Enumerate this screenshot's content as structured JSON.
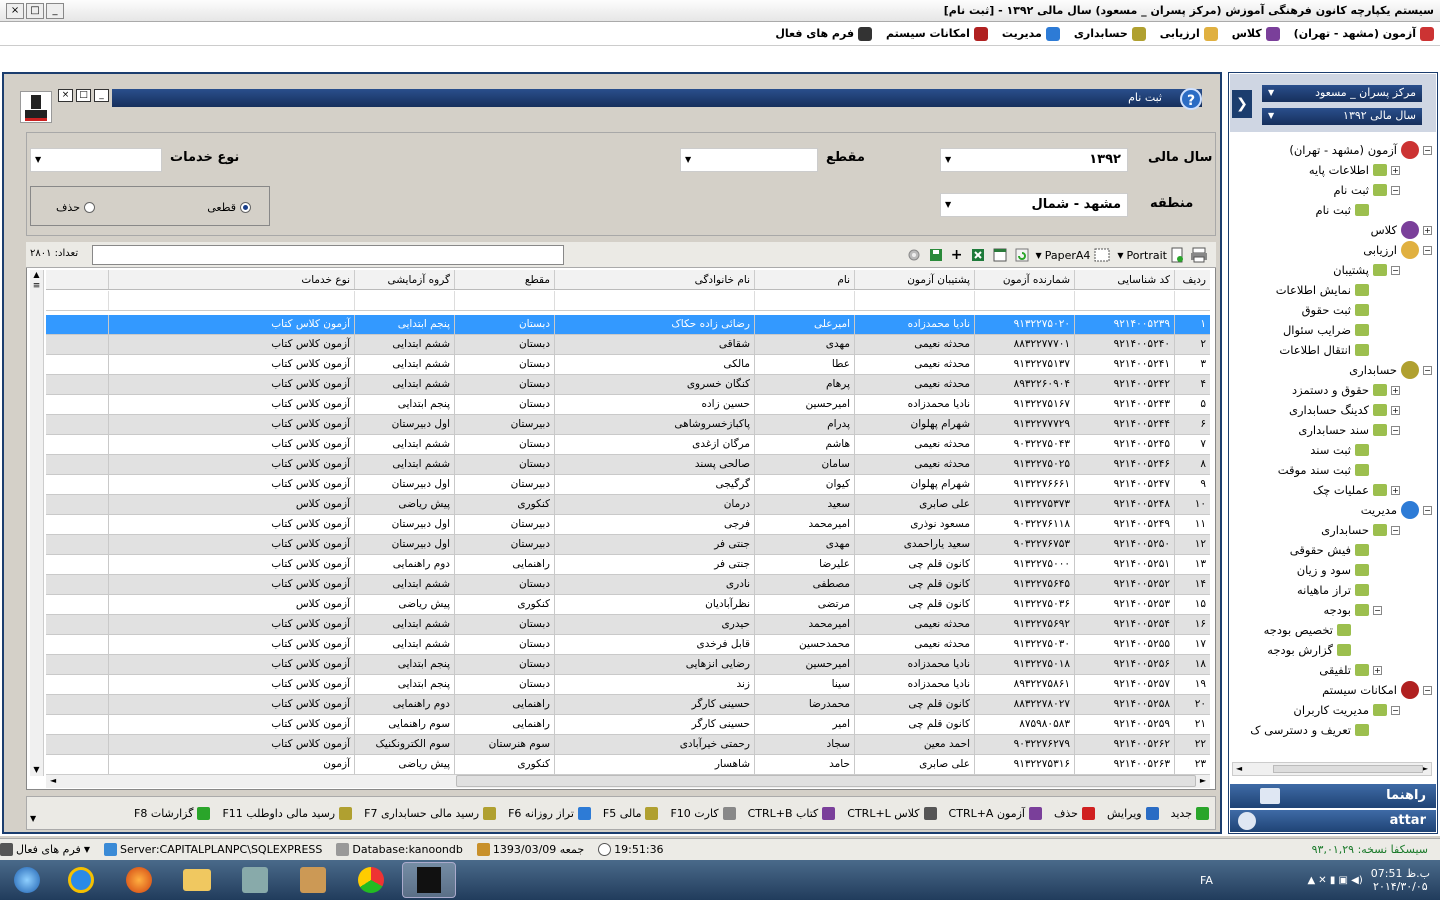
{
  "window": {
    "title": "سیستم یکپارچه کانون فرهنگی آموزش  (مرکز پسران _ مسعود) سال مالی ۱۳۹۲ - [ثبت نام]",
    "controls": [
      "_",
      "□",
      "×"
    ]
  },
  "menubar": [
    {
      "label": "آزمون (مشهد - تهران)",
      "icon": "puzzle-icon",
      "color": "#c33"
    },
    {
      "label": "کلاس",
      "icon": "chess-icon",
      "color": "#7a3f9a"
    },
    {
      "label": "ارزیابی",
      "icon": "gauge-icon",
      "color": "#e0b040"
    },
    {
      "label": "حسابداری",
      "icon": "money-bag-icon",
      "color": "#b0a030"
    },
    {
      "label": "مدیریت",
      "icon": "gear-icon",
      "color": "#2d7bd6"
    },
    {
      "label": "امکانات سیستم",
      "icon": "grid-icon",
      "color": "#b02020"
    },
    {
      "label": "فرم های فعال",
      "icon": "window-icon",
      "color": "#333"
    }
  ],
  "form": {
    "title": "ثبت نام",
    "filters": {
      "year_label": "سال مالی",
      "year_value": "۱۳۹۲",
      "grade_label": "مقطع",
      "grade_value": "",
      "service_label": "نوع خدمات",
      "service_value": "",
      "region_label": "منطقه",
      "region_value": "مشهد - شمال",
      "radio_final": "قطعی",
      "radio_delete": "حذف"
    },
    "toolbar": {
      "portrait": "Portrait",
      "paper": "PaperA4",
      "plus": "+",
      "count": "تعداد: ۲۸۰۱"
    },
    "columns": [
      "ردیف",
      "کد شناسایی",
      "شمارنده آزمون",
      "پشتیبان آزمون",
      "نام",
      "نام خانوادگی",
      "مقطع",
      "گروه آزمایشی",
      "نوع خدمات"
    ],
    "rows": [
      [
        "۱",
        "۹۲۱۴۰۰۵۲۳۹",
        "۹۱۳۲۲۷۵۰۲۰",
        "نادیا محمدزاده",
        "امیرعلی",
        "رضائی زاده حکاک",
        "دبستان",
        "پنجم ابتدایی",
        "آزمون  کلاس کتاب"
      ],
      [
        "۲",
        "۹۲۱۴۰۰۵۲۴۰",
        "۸۸۳۲۲۷۷۷۰۱",
        "محدثه نعیمی",
        "مهدی",
        "شقاقی",
        "دبستان",
        "ششم ابتدایی",
        "آزمون  کلاس کتاب"
      ],
      [
        "۳",
        "۹۲۱۴۰۰۵۲۴۱",
        "۹۱۳۲۲۷۵۱۳۷",
        "محدثه نعیمی",
        "عطا",
        "مالکی",
        "دبستان",
        "ششم ابتدایی",
        "آزمون  کلاس کتاب"
      ],
      [
        "۴",
        "۹۲۱۴۰۰۵۲۴۲",
        "۸۹۳۲۲۶۰۹۰۴",
        "محدثه نعیمی",
        "پرهام",
        "کنگان خسروی",
        "دبستان",
        "ششم ابتدایی",
        "آزمون  کلاس کتاب"
      ],
      [
        "۵",
        "۹۲۱۴۰۰۵۲۴۳",
        "۹۱۳۲۲۷۵۱۶۷",
        "نادیا محمدزاده",
        "امیرحسین",
        "حسین زاده",
        "دبستان",
        "پنجم ابتدایی",
        "آزمون  کلاس کتاب"
      ],
      [
        "۶",
        "۹۲۱۴۰۰۵۲۴۴",
        "۹۱۳۲۲۷۷۷۲۹",
        "شهرام پهلوان",
        "پدرام",
        "پاکبازخسروشاهی",
        "دبیرستان",
        "اول دبیرستان",
        "آزمون  کلاس کتاب"
      ],
      [
        "۷",
        "۹۲۱۴۰۰۵۲۴۵",
        "۹۰۳۲۲۷۵۰۴۳",
        "محدثه نعیمی",
        "هاشم",
        "مرگان ازغدی",
        "دبستان",
        "ششم ابتدایی",
        "آزمون  کلاس کتاب"
      ],
      [
        "۸",
        "۹۲۱۴۰۰۵۲۴۶",
        "۹۱۳۲۲۷۵۰۲۵",
        "محدثه نعیمی",
        "سامان",
        "صالحی پسند",
        "دبستان",
        "ششم ابتدایی",
        "آزمون  کلاس کتاب"
      ],
      [
        "۹",
        "۹۲۱۴۰۰۵۲۴۷",
        "۹۱۳۲۲۷۶۶۶۱",
        "شهرام پهلوان",
        "کیوان",
        "گرگیجی",
        "دبیرستان",
        "اول دبیرستان",
        "آزمون  کلاس کتاب"
      ],
      [
        "۱۰",
        "۹۲۱۴۰۰۵۲۴۸",
        "۹۱۳۲۲۷۵۳۷۳",
        "علی صابری",
        "سعید",
        "درمان",
        "کنکوری",
        "پیش ریاضی",
        "آزمون  کلاس"
      ],
      [
        "۱۱",
        "۹۲۱۴۰۰۵۲۴۹",
        "۹۰۳۲۲۷۶۱۱۸",
        "مسعود نوذری",
        "امیرمحمد",
        "فرجی",
        "دبیرستان",
        "اول دبیرستان",
        "آزمون  کلاس کتاب"
      ],
      [
        "۱۲",
        "۹۲۱۴۰۰۵۲۵۰",
        "۹۰۳۲۲۷۶۷۵۳",
        "سعید یاراحمدی",
        "مهدی",
        "جنتی فر",
        "دبیرستان",
        "اول دبیرستان",
        "آزمون  کلاس کتاب"
      ],
      [
        "۱۳",
        "۹۲۱۴۰۰۵۲۵۱",
        "۹۱۳۲۲۷۵۰۰۰",
        "کانون قلم چی",
        "علیرضا",
        "جنتی فر",
        "راهنمایی",
        "دوم راهنمایی",
        "آزمون  کلاس کتاب"
      ],
      [
        "۱۴",
        "۹۲۱۴۰۰۵۲۵۲",
        "۹۱۳۲۲۷۵۶۴۵",
        "کانون قلم چی",
        "مصطفی",
        "نادری",
        "دبستان",
        "ششم ابتدایی",
        "آزمون  کلاس کتاب"
      ],
      [
        "۱۵",
        "۹۲۱۴۰۰۵۲۵۳",
        "۹۱۳۲۲۷۵۰۳۶",
        "کانون قلم چی",
        "مرتضی",
        "نظرآبادیان",
        "کنکوری",
        "پیش ریاضی",
        "آزمون  کلاس"
      ],
      [
        "۱۶",
        "۹۲۱۴۰۰۵۲۵۴",
        "۹۱۳۲۲۷۵۶۹۲",
        "محدثه نعیمی",
        "امیرمحمد",
        "حیدری",
        "دبستان",
        "ششم ابتدایی",
        "آزمون  کلاس کتاب"
      ],
      [
        "۱۷",
        "۹۲۱۴۰۰۵۲۵۵",
        "۹۱۳۲۲۷۵۰۳۰",
        "محدثه نعیمی",
        "محمدحسین",
        "قابل فرخدی",
        "دبستان",
        "ششم ابتدایی",
        "آزمون  کلاس کتاب"
      ],
      [
        "۱۸",
        "۹۲۱۴۰۰۵۲۵۶",
        "۹۱۳۲۲۷۵۰۱۸",
        "نادیا محمدزاده",
        "امیرحسین",
        "رضایی انزهایی",
        "دبستان",
        "پنجم ابتدایی",
        "آزمون  کلاس کتاب"
      ],
      [
        "۱۹",
        "۹۲۱۴۰۰۵۲۵۷",
        "۸۹۳۲۲۷۵۸۶۱",
        "نادیا محمدزاده",
        "سینا",
        "زند",
        "دبستان",
        "پنجم ابتدایی",
        "آزمون  کلاس کتاب"
      ],
      [
        "۲۰",
        "۹۲۱۴۰۰۵۲۵۸",
        "۸۸۳۲۲۷۸۰۲۷",
        "کانون قلم چی",
        "محمدرضا",
        "حسینی کارگر",
        "راهنمایی",
        "دوم راهنمایی",
        "آزمون  کلاس کتاب"
      ],
      [
        "۲۱",
        "۹۲۱۴۰۰۵۲۵۹",
        "۸۷۵۹۸۰۵۸۳",
        "کانون قلم چی",
        "امیر",
        "حسینی کارگر",
        "راهنمایی",
        "سوم راهنمایی",
        "آزمون  کلاس کتاب"
      ],
      [
        "۲۲",
        "۹۲۱۴۰۰۵۲۶۲",
        "۹۰۳۲۲۷۶۲۷۹",
        "احمد معین",
        "سجاد",
        "رحمتی خیرآبادی",
        "سوم هنرستان",
        "سوم الکترونکنیک",
        "آزمون  کلاس کتاب"
      ],
      [
        "۲۳",
        "۹۲۱۴۰۰۵۲۶۳",
        "۹۱۳۲۲۷۵۳۱۶",
        "علی صابری",
        "حامد",
        "شاهسار",
        "کنکوری",
        "پیش ریاضی",
        "آزمون"
      ]
    ],
    "actions": [
      {
        "label": "جدید",
        "icon": "add-icon",
        "color": "#2aa52a"
      },
      {
        "label": "ویرایش",
        "icon": "edit-icon",
        "color": "#2a6cc4"
      },
      {
        "label": "حذف",
        "icon": "delete-icon",
        "color": "#d02020"
      },
      {
        "label": "آزمون CTRL+A",
        "icon": "exam-icon",
        "color": "#7a3f9a"
      },
      {
        "label": "کلاس CTRL+L",
        "icon": "class-icon",
        "color": "#555"
      },
      {
        "label": "کتاب CTRL+B",
        "icon": "book-icon",
        "color": "#7a3f9a"
      },
      {
        "label": "کارت F10",
        "icon": "card-icon",
        "color": "#888"
      },
      {
        "label": "مالی F5",
        "icon": "money-icon",
        "color": "#b0a030"
      },
      {
        "label": "تراز روزانه F6",
        "icon": "balance-icon",
        "color": "#2d7bd6"
      },
      {
        "label": "رسید مالی حسابداری F7",
        "icon": "receipt-icon",
        "color": "#b0a030"
      },
      {
        "label": "رسید مالی داوطلب F11",
        "icon": "receipt-icon",
        "color": "#b0a030"
      },
      {
        "label": "گزارشات F8",
        "icon": "report-icon",
        "color": "#2aa52a"
      }
    ]
  },
  "rightpanel": {
    "center": "مرکز پسران _ مسعود",
    "year": "سال مالی ۱۳۹۲",
    "tree": [
      {
        "label": "آزمون (مشهد - تهران)",
        "level": 0,
        "pm": "−",
        "big": true,
        "color": "#c33"
      },
      {
        "label": "اطلاعات پایه",
        "level": 1,
        "pm": "+"
      },
      {
        "label": "ثبت نام",
        "level": 1,
        "pm": "−"
      },
      {
        "label": "ثبت نام",
        "level": 2,
        "pm": ""
      },
      {
        "label": "کلاس",
        "level": 0,
        "pm": "+",
        "big": true,
        "color": "#7a3f9a"
      },
      {
        "label": "ارزیابی",
        "level": 0,
        "pm": "−",
        "big": true,
        "color": "#e0b040"
      },
      {
        "label": "پشتیبان",
        "level": 1,
        "pm": "−"
      },
      {
        "label": "نمایش اطلاعات",
        "level": 2,
        "pm": ""
      },
      {
        "label": "ثبت حقوق",
        "level": 2,
        "pm": ""
      },
      {
        "label": "ضرایب سئوال",
        "level": 2,
        "pm": ""
      },
      {
        "label": "انتقال اطلاعات",
        "level": 2,
        "pm": ""
      },
      {
        "label": "حسابداری",
        "level": 0,
        "pm": "−",
        "big": true,
        "color": "#b0a030"
      },
      {
        "label": "حقوق و دستمزد",
        "level": 1,
        "pm": "+"
      },
      {
        "label": "کدینگ حسابداری",
        "level": 1,
        "pm": "+"
      },
      {
        "label": "سند حسابداری",
        "level": 1,
        "pm": "−"
      },
      {
        "label": "ثبت سند",
        "level": 2,
        "pm": ""
      },
      {
        "label": "ثبت سند موقت",
        "level": 2,
        "pm": ""
      },
      {
        "label": "عملیات چک",
        "level": 1,
        "pm": "+"
      },
      {
        "label": "مدیریت",
        "level": 0,
        "pm": "−",
        "big": true,
        "color": "#2d7bd6"
      },
      {
        "label": "حسابداری",
        "level": 1,
        "pm": "−"
      },
      {
        "label": "فیش حقوقی",
        "level": 2,
        "pm": ""
      },
      {
        "label": "سود و زیان",
        "level": 2,
        "pm": ""
      },
      {
        "label": "تراز ماهیانه",
        "level": 2,
        "pm": ""
      },
      {
        "label": "بودجه",
        "level": 2,
        "pm": "−"
      },
      {
        "label": "تخصیص بودجه",
        "level": 3,
        "pm": ""
      },
      {
        "label": "گزارش بودجه",
        "level": 3,
        "pm": ""
      },
      {
        "label": "تلفیقی",
        "level": 2,
        "pm": "+"
      },
      {
        "label": "امکانات سیستم",
        "level": 0,
        "pm": "−",
        "big": true,
        "color": "#b02020"
      },
      {
        "label": "مدیریت کاربران",
        "level": 1,
        "pm": "−"
      },
      {
        "label": "تعریف و دسترسی ک",
        "level": 2,
        "pm": ""
      }
    ],
    "rahnama": "راهنما",
    "attar": "attar"
  },
  "statusbar": {
    "active_forms": "فرم های فعال",
    "server": "Server:CAPITALPLANPC\\SQLEXPRESS",
    "database": "Database:kanoondb",
    "date": "1393/03/09  جمعه",
    "time": "19:51:36",
    "version": "سیسکفا  نسخه: ۹۳,۰۱,۲۹"
  },
  "taskbar": {
    "lang": "FA",
    "clock_time": "ب.ظ 07:51",
    "clock_date": "۲۰۱۴/۳۰/۰۵"
  }
}
